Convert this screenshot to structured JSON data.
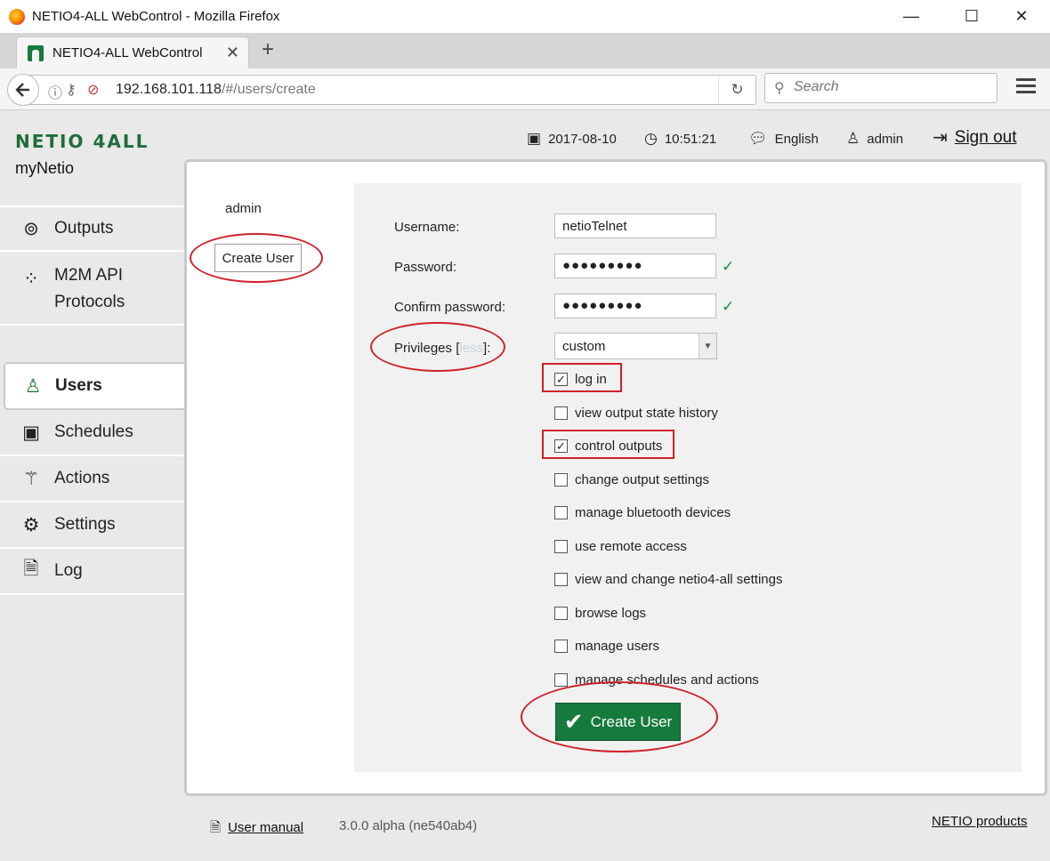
{
  "window": {
    "title": "NETIO4-ALL WebControl - Mozilla Firefox",
    "minimize_glyph": "—",
    "maximize_glyph": "☐",
    "close_glyph": "✕"
  },
  "tab": {
    "title": "NETIO4-ALL WebControl",
    "close_glyph": "✕",
    "new_tab_glyph": "+"
  },
  "navbar": {
    "url_host": "192.168.101.118",
    "url_path": "/#/users/create",
    "search_placeholder": "Search"
  },
  "header": {
    "brand": "NETIO 4ALL",
    "device_name": "myNetio",
    "date": "2017-08-10",
    "time": "10:51:21",
    "language": "English",
    "user": "admin",
    "sign_out": "Sign out"
  },
  "sidebar": {
    "items": [
      {
        "label": "Outputs",
        "icon": "outlet-icon"
      },
      {
        "label": "M2M API",
        "label2": "Protocols",
        "icon": "m2m-icon"
      },
      {
        "label": "Users",
        "icon": "user-icon",
        "active": true
      },
      {
        "label": "Schedules",
        "icon": "calendar-icon"
      },
      {
        "label": "Actions",
        "icon": "magic-wand-icon"
      },
      {
        "label": "Settings",
        "icon": "gear-icon"
      },
      {
        "label": "Log",
        "icon": "document-icon"
      }
    ]
  },
  "users": {
    "list": [
      "admin"
    ],
    "create_button": "Create User"
  },
  "form": {
    "username_label": "Username:",
    "username_value": "netioTelnet",
    "password_label": "Password:",
    "password_value": "●●●●●●●●●",
    "confirm_label": "Confirm password:",
    "confirm_value": "●●●●●●●●●",
    "privileges_label_pre": "Privileges [",
    "privileges_less": "less",
    "privileges_label_post": "]:",
    "privileges_value": "custom",
    "privileges": [
      {
        "label": "log in",
        "checked": true
      },
      {
        "label": "view output state history",
        "checked": false
      },
      {
        "label": "control outputs",
        "checked": true
      },
      {
        "label": "change output settings",
        "checked": false
      },
      {
        "label": "manage bluetooth devices",
        "checked": false
      },
      {
        "label": "use remote access",
        "checked": false
      },
      {
        "label": "view and change netio4-all settings",
        "checked": false
      },
      {
        "label": "browse logs",
        "checked": false
      },
      {
        "label": "manage users",
        "checked": false
      },
      {
        "label": "manage schedules and actions",
        "checked": false
      }
    ],
    "submit_label": "Create User"
  },
  "footer": {
    "manual": "User manual",
    "version": "3.0.0 alpha (ne540ab4)",
    "products": "NETIO products"
  },
  "colors": {
    "brand_green": "#167a3d",
    "annotation_red": "#d0202a",
    "valid_check": "#1f8a3c"
  }
}
